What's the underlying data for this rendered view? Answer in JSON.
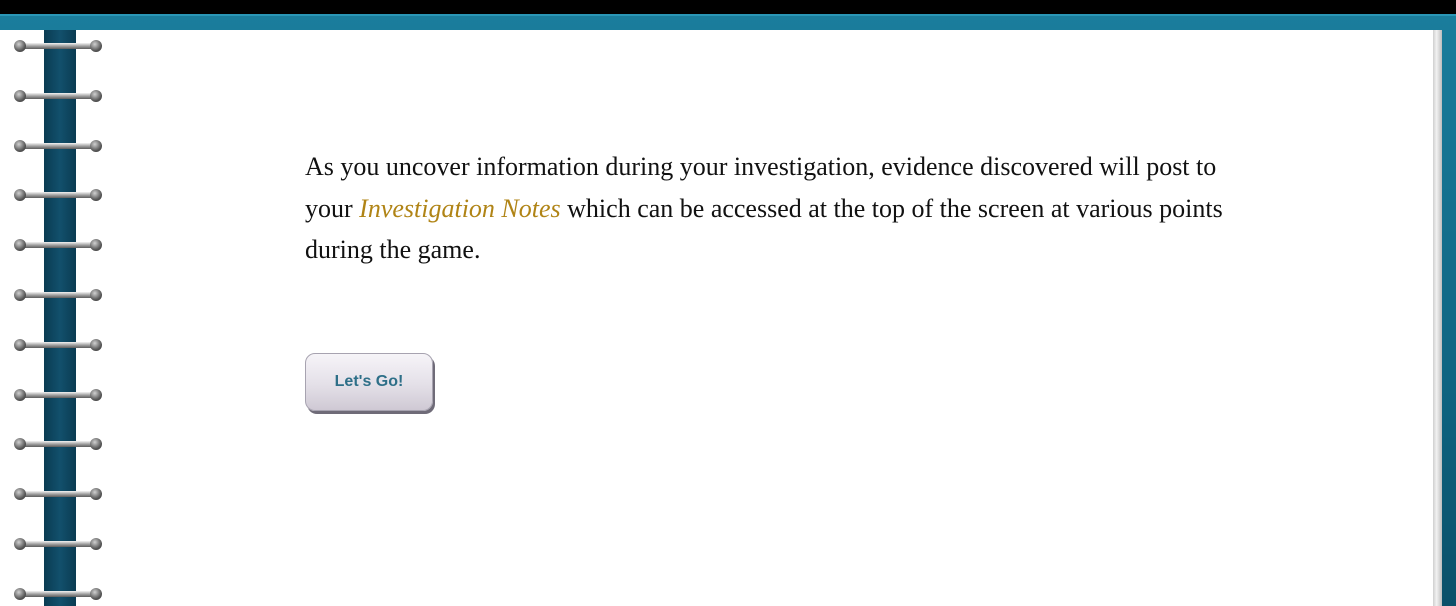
{
  "message": {
    "before": "As you uncover information during your investigation, evidence discovered will post to your ",
    "highlight": "Investigation Notes",
    "after": " which can be accessed at the top of the screen at various points during the game."
  },
  "button": {
    "label": "Let's Go!"
  },
  "colors": {
    "cover": "#0f6582",
    "spine": "#12506c",
    "highlight": "#b08416",
    "button_text": "#2e6f88"
  },
  "icons": {
    "binding": "spiral-ring-icon"
  }
}
